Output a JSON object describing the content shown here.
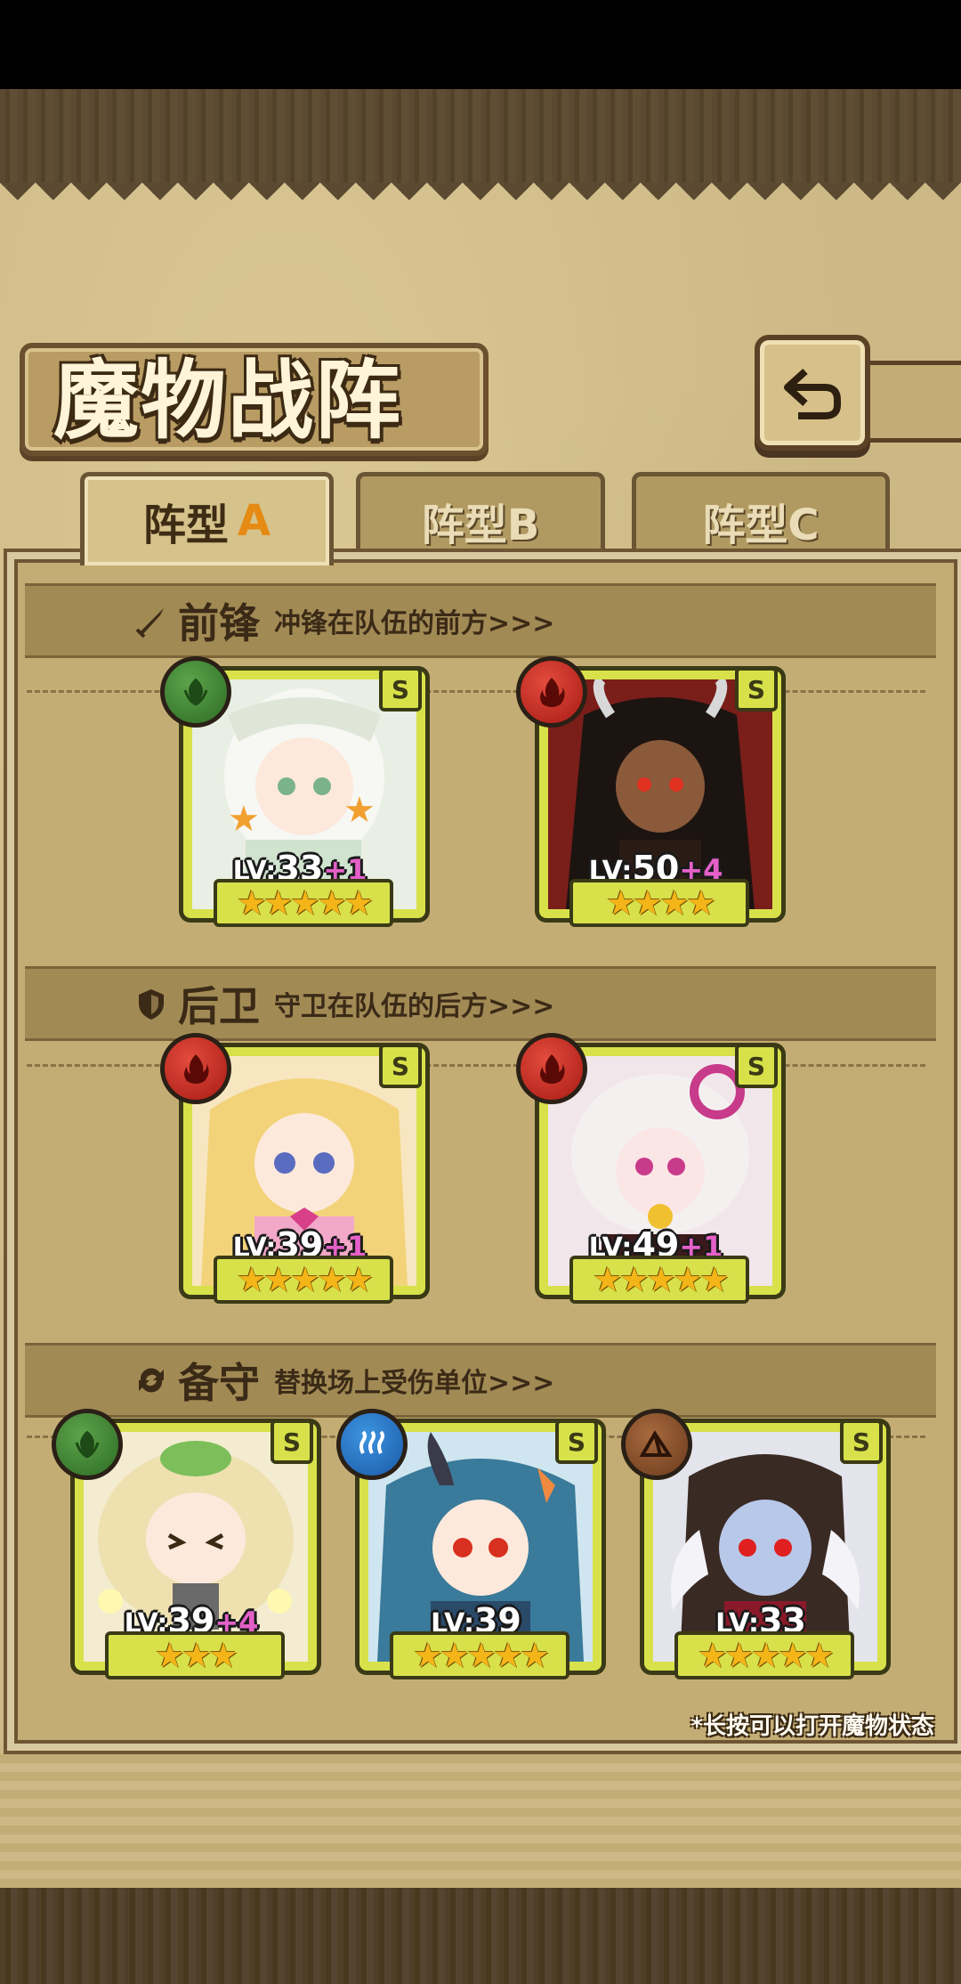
{
  "header": {
    "title": "魔物战阵",
    "back_button_icon": "back-arrow-icon"
  },
  "tabs": [
    {
      "label": "阵型",
      "suffix": "A",
      "active": true
    },
    {
      "label": "阵型B",
      "active": false
    },
    {
      "label": "阵型C",
      "active": false
    }
  ],
  "sections": {
    "front": {
      "title": "前锋",
      "desc": "冲锋在队伍的前方>>>",
      "icon": "sword-icon"
    },
    "rear": {
      "title": "后卫",
      "desc": "守卫在队伍的后方>>>",
      "icon": "shield-icon"
    },
    "reserve": {
      "title": "备守",
      "desc": "替换场上受伤单位>>>",
      "icon": "swap-icon"
    }
  },
  "cards": {
    "front_1": {
      "element": "leaf-icon",
      "rank": "S",
      "lv_label": "LV:",
      "level": "33",
      "bonus": "+1",
      "stars": 5,
      "stars_text": "★★★★★"
    },
    "front_2": {
      "element": "flame-icon",
      "rank": "S",
      "lv_label": "LV:",
      "level": "50",
      "bonus": "+4",
      "stars": 4,
      "stars_text": "★★★★"
    },
    "rear_1": {
      "element": "flame-icon",
      "rank": "S",
      "lv_label": "LV:",
      "level": "39",
      "bonus": "+1",
      "stars": 5,
      "stars_text": "★★★★★"
    },
    "rear_2": {
      "element": "flame-icon",
      "rank": "S",
      "lv_label": "LV:",
      "level": "49",
      "bonus": "+1",
      "stars": 5,
      "stars_text": "★★★★★"
    },
    "reserve_1": {
      "element": "leaf-icon",
      "rank": "S",
      "lv_label": "LV:",
      "level": "39",
      "bonus": "+4",
      "stars": 3,
      "stars_text": "★★★"
    },
    "reserve_2": {
      "element": "water-icon",
      "rank": "S",
      "lv_label": "LV:",
      "level": "39",
      "bonus": "",
      "stars": 5,
      "stars_text": "★★★★★"
    },
    "reserve_3": {
      "element": "mountain-icon",
      "rank": "S",
      "lv_label": "LV:",
      "level": "33",
      "bonus": "",
      "stars": 5,
      "stars_text": "★★★★★"
    }
  },
  "footer_note": "*长按可以打开魔物状态",
  "colors": {
    "card_frame": "#d8e14a",
    "fire": "#c8261c",
    "wood": "#3f8a33",
    "water": "#2a78c8",
    "earth": "#8a5230",
    "bonus": "#e460c8",
    "star": "#f4b518"
  }
}
